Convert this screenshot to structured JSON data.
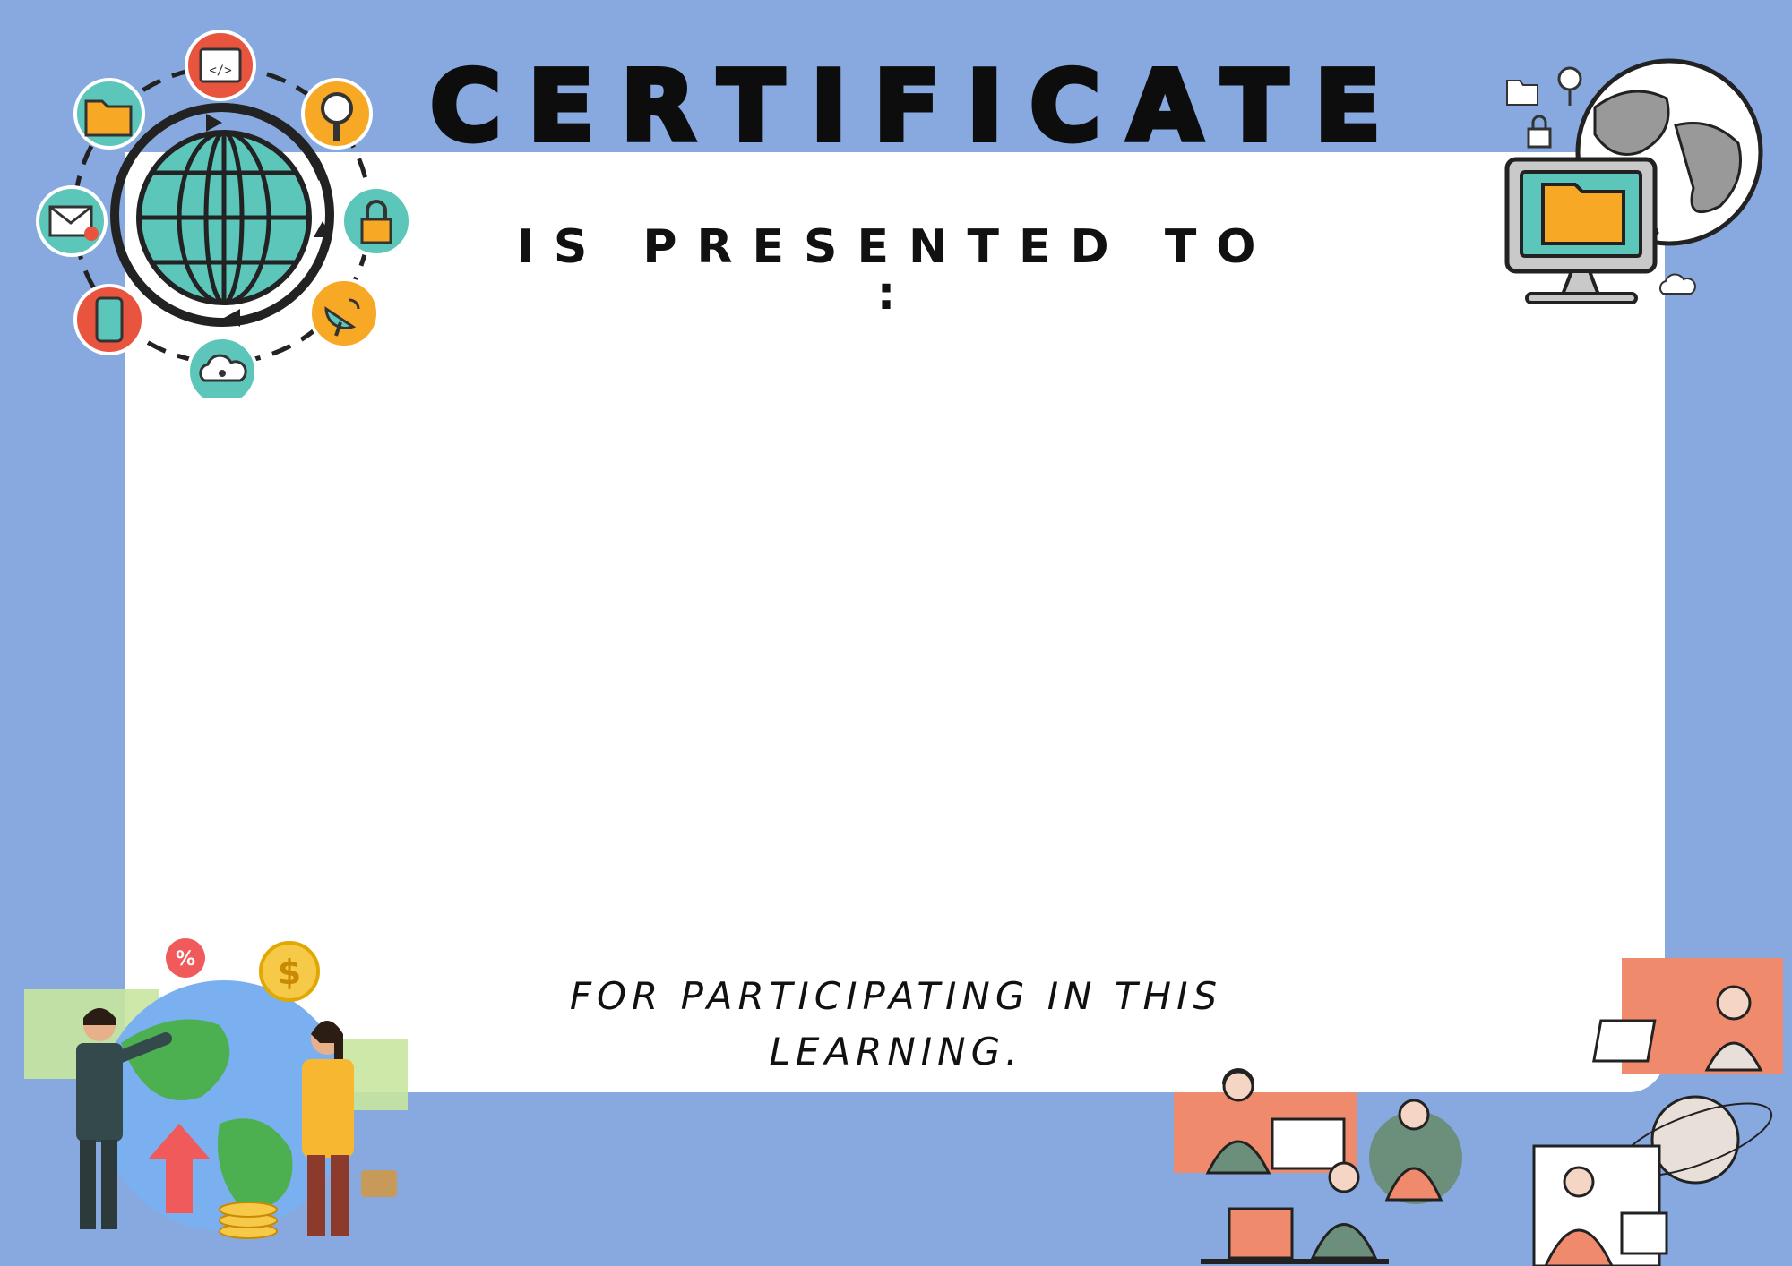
{
  "certificate": {
    "title": "CERTIFICATE",
    "presented_to": "IS PRESENTED TO :",
    "reason": "FOR PARTICIPATING IN THIS LEARNING.",
    "recipient_name": ""
  },
  "icons": {
    "network_cluster": [
      "code-window-icon",
      "magnifier-icon",
      "lock-icon",
      "satellite-dish-icon",
      "cloud-lock-icon",
      "smartphone-icon",
      "mail-alert-icon",
      "folder-icon",
      "globe-icon"
    ],
    "top_right": [
      "globe-icon",
      "monitor-folder-icon",
      "folder-icon",
      "search-icon",
      "lock-icon",
      "cloud-lock-icon"
    ],
    "bottom_left": [
      "business-people-illustration",
      "globe-icon",
      "dollar-coin-icon",
      "percent-badge-icon",
      "arrow-up-icon",
      "chart-card-icon",
      "briefcase-icon"
    ],
    "bottom_right": [
      "call-center-agents-illustration",
      "laptop-icon",
      "headset-icon",
      "globe-icon"
    ]
  },
  "colors": {
    "background": "#87a9e0",
    "panel": "#ffffff",
    "teal": "#5cc6bb",
    "orange": "#f7a824",
    "red": "#e8543e",
    "salmon": "#f08a6c",
    "green_shirt": "#6b8f7b",
    "dark": "#1f1f1f"
  }
}
